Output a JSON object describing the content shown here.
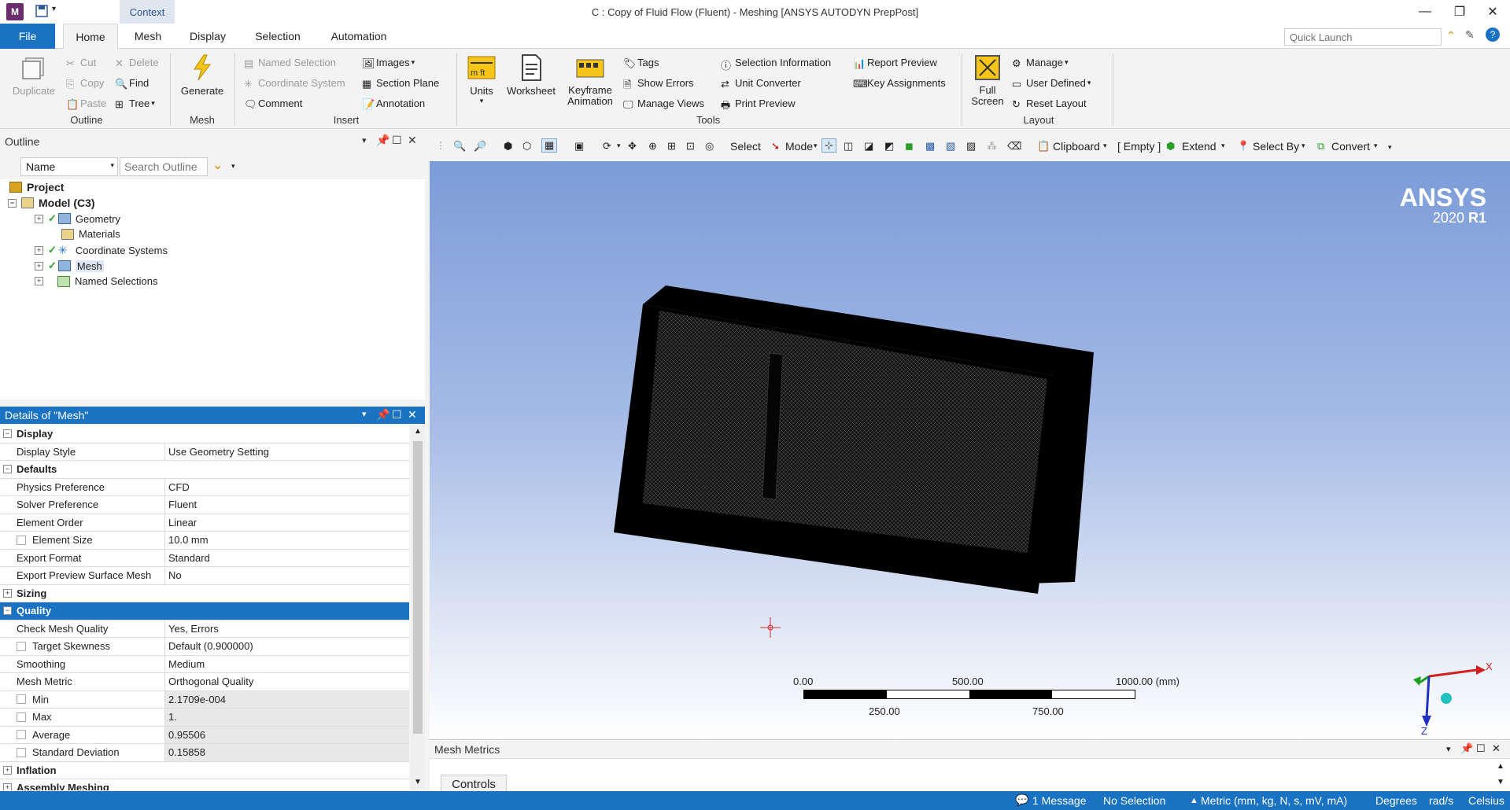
{
  "title_bar": {
    "app_icon_letter": "M",
    "context_tab": "Context",
    "title": "C : Copy of Fluid Flow (Fluent) - Meshing [ANSYS AUTODYN PrepPost]"
  },
  "ribbon_tabs": [
    "File",
    "Home",
    "Mesh",
    "Display",
    "Selection",
    "Automation"
  ],
  "quick_launch_placeholder": "Quick Launch",
  "ribbon": {
    "outline_group": {
      "label": "Outline",
      "duplicate": "Duplicate",
      "cut": "Cut",
      "copy": "Copy",
      "paste": "Paste",
      "delete": "Delete",
      "find": "Find",
      "tree": "Tree"
    },
    "mesh_group": {
      "label": "Mesh",
      "generate": "Generate"
    },
    "insert_group": {
      "label": "Insert",
      "named_selection": "Named Selection",
      "coordinate_system": "Coordinate System",
      "comment": "Comment",
      "images": "Images",
      "section_plane": "Section Plane",
      "annotation": "Annotation"
    },
    "tools_group": {
      "label": "Tools",
      "units": "Units",
      "worksheet": "Worksheet",
      "keyframe": "Keyframe",
      "animation": "Animation",
      "tags": "Tags",
      "show_errors": "Show Errors",
      "manage_views": "Manage Views",
      "selection_information": "Selection Information",
      "unit_converter": "Unit Converter",
      "print_preview": "Print Preview",
      "report_preview": "Report Preview",
      "key_assignments": "Key Assignments"
    },
    "layout_group": {
      "label": "Layout",
      "full": "Full",
      "screen": "Screen",
      "manage": "Manage",
      "user_defined": "User Defined",
      "reset_layout": "Reset Layout"
    }
  },
  "outline": {
    "header": "Outline",
    "filter_label": "Name",
    "search_placeholder": "Search Outline",
    "tree": [
      {
        "label": "Project",
        "level": 0,
        "icon": "project-icon"
      },
      {
        "label": "Model (C3)",
        "level": 1,
        "icon": "model-icon"
      },
      {
        "label": "Geometry",
        "level": 2,
        "icon": "geometry-icon"
      },
      {
        "label": "Materials",
        "level": 2,
        "icon": "materials-icon"
      },
      {
        "label": "Coordinate Systems",
        "level": 2,
        "icon": "coordinate-systems-icon"
      },
      {
        "label": "Mesh",
        "level": 2,
        "icon": "mesh-icon"
      },
      {
        "label": "Named Selections",
        "level": 2,
        "icon": "named-selections-icon"
      }
    ]
  },
  "details": {
    "header": "Details of \"Mesh\"",
    "rows": [
      {
        "key": "Display",
        "type": "group",
        "state": "−"
      },
      {
        "key": "Display Style",
        "value": "Use Geometry Setting"
      },
      {
        "key": "Defaults",
        "type": "group",
        "state": "−"
      },
      {
        "key": "Physics Preference",
        "value": "CFD"
      },
      {
        "key": "Solver Preference",
        "value": "Fluent"
      },
      {
        "key": "Element Order",
        "value": "Linear"
      },
      {
        "key": "Element Size",
        "value": "10.0 mm",
        "checkbox": true
      },
      {
        "key": "Export Format",
        "value": "Standard"
      },
      {
        "key": "Export Preview Surface Mesh",
        "value": "No"
      },
      {
        "key": "Sizing",
        "type": "group",
        "state": "+"
      },
      {
        "key": "Quality",
        "type": "group",
        "state": "−",
        "selected": true
      },
      {
        "key": "Check Mesh Quality",
        "value": "Yes, Errors"
      },
      {
        "key": "Target Skewness",
        "value": "Default (0.900000)",
        "checkbox": true
      },
      {
        "key": "Smoothing",
        "value": "Medium"
      },
      {
        "key": "Mesh Metric",
        "value": "Orthogonal Quality"
      },
      {
        "key": "Min",
        "value": "2.1709e-004",
        "checkbox": true,
        "readonly": true
      },
      {
        "key": "Max",
        "value": "1.",
        "checkbox": true,
        "readonly": true
      },
      {
        "key": "Average",
        "value": "0.95506",
        "checkbox": true,
        "readonly": true
      },
      {
        "key": "Standard Deviation",
        "value": "0.15858",
        "checkbox": true,
        "readonly": true
      },
      {
        "key": "Inflation",
        "type": "group",
        "state": "+"
      },
      {
        "key": "Assembly Meshing",
        "type": "group",
        "state": "+"
      }
    ]
  },
  "graphics_toolbar": {
    "select": "Select",
    "mode": "Mode",
    "clipboard": "Clipboard",
    "empty": "[ Empty ]",
    "extend": "Extend",
    "select_by": "Select By",
    "convert": "Convert"
  },
  "viewport": {
    "brand": "ANSYS",
    "version_year": "2020",
    "version_release": "R1",
    "scale_labels_top": [
      "0.00",
      "500.00",
      "1000.00 (mm)"
    ],
    "scale_labels_bottom": [
      "250.00",
      "750.00"
    ],
    "axis_x": "X",
    "axis_z": "Z"
  },
  "mesh_metrics": {
    "title": "Mesh Metrics",
    "tab": "Controls"
  },
  "status": {
    "message": "1 Message",
    "selection": "No Selection",
    "units": "Metric (mm, kg, N, s, mV, mA)",
    "angle": "Degrees",
    "rate": "rad/s",
    "temperature": "Celsius"
  },
  "colors": {
    "accent": "#1a73c2",
    "mesh": "#000000"
  }
}
